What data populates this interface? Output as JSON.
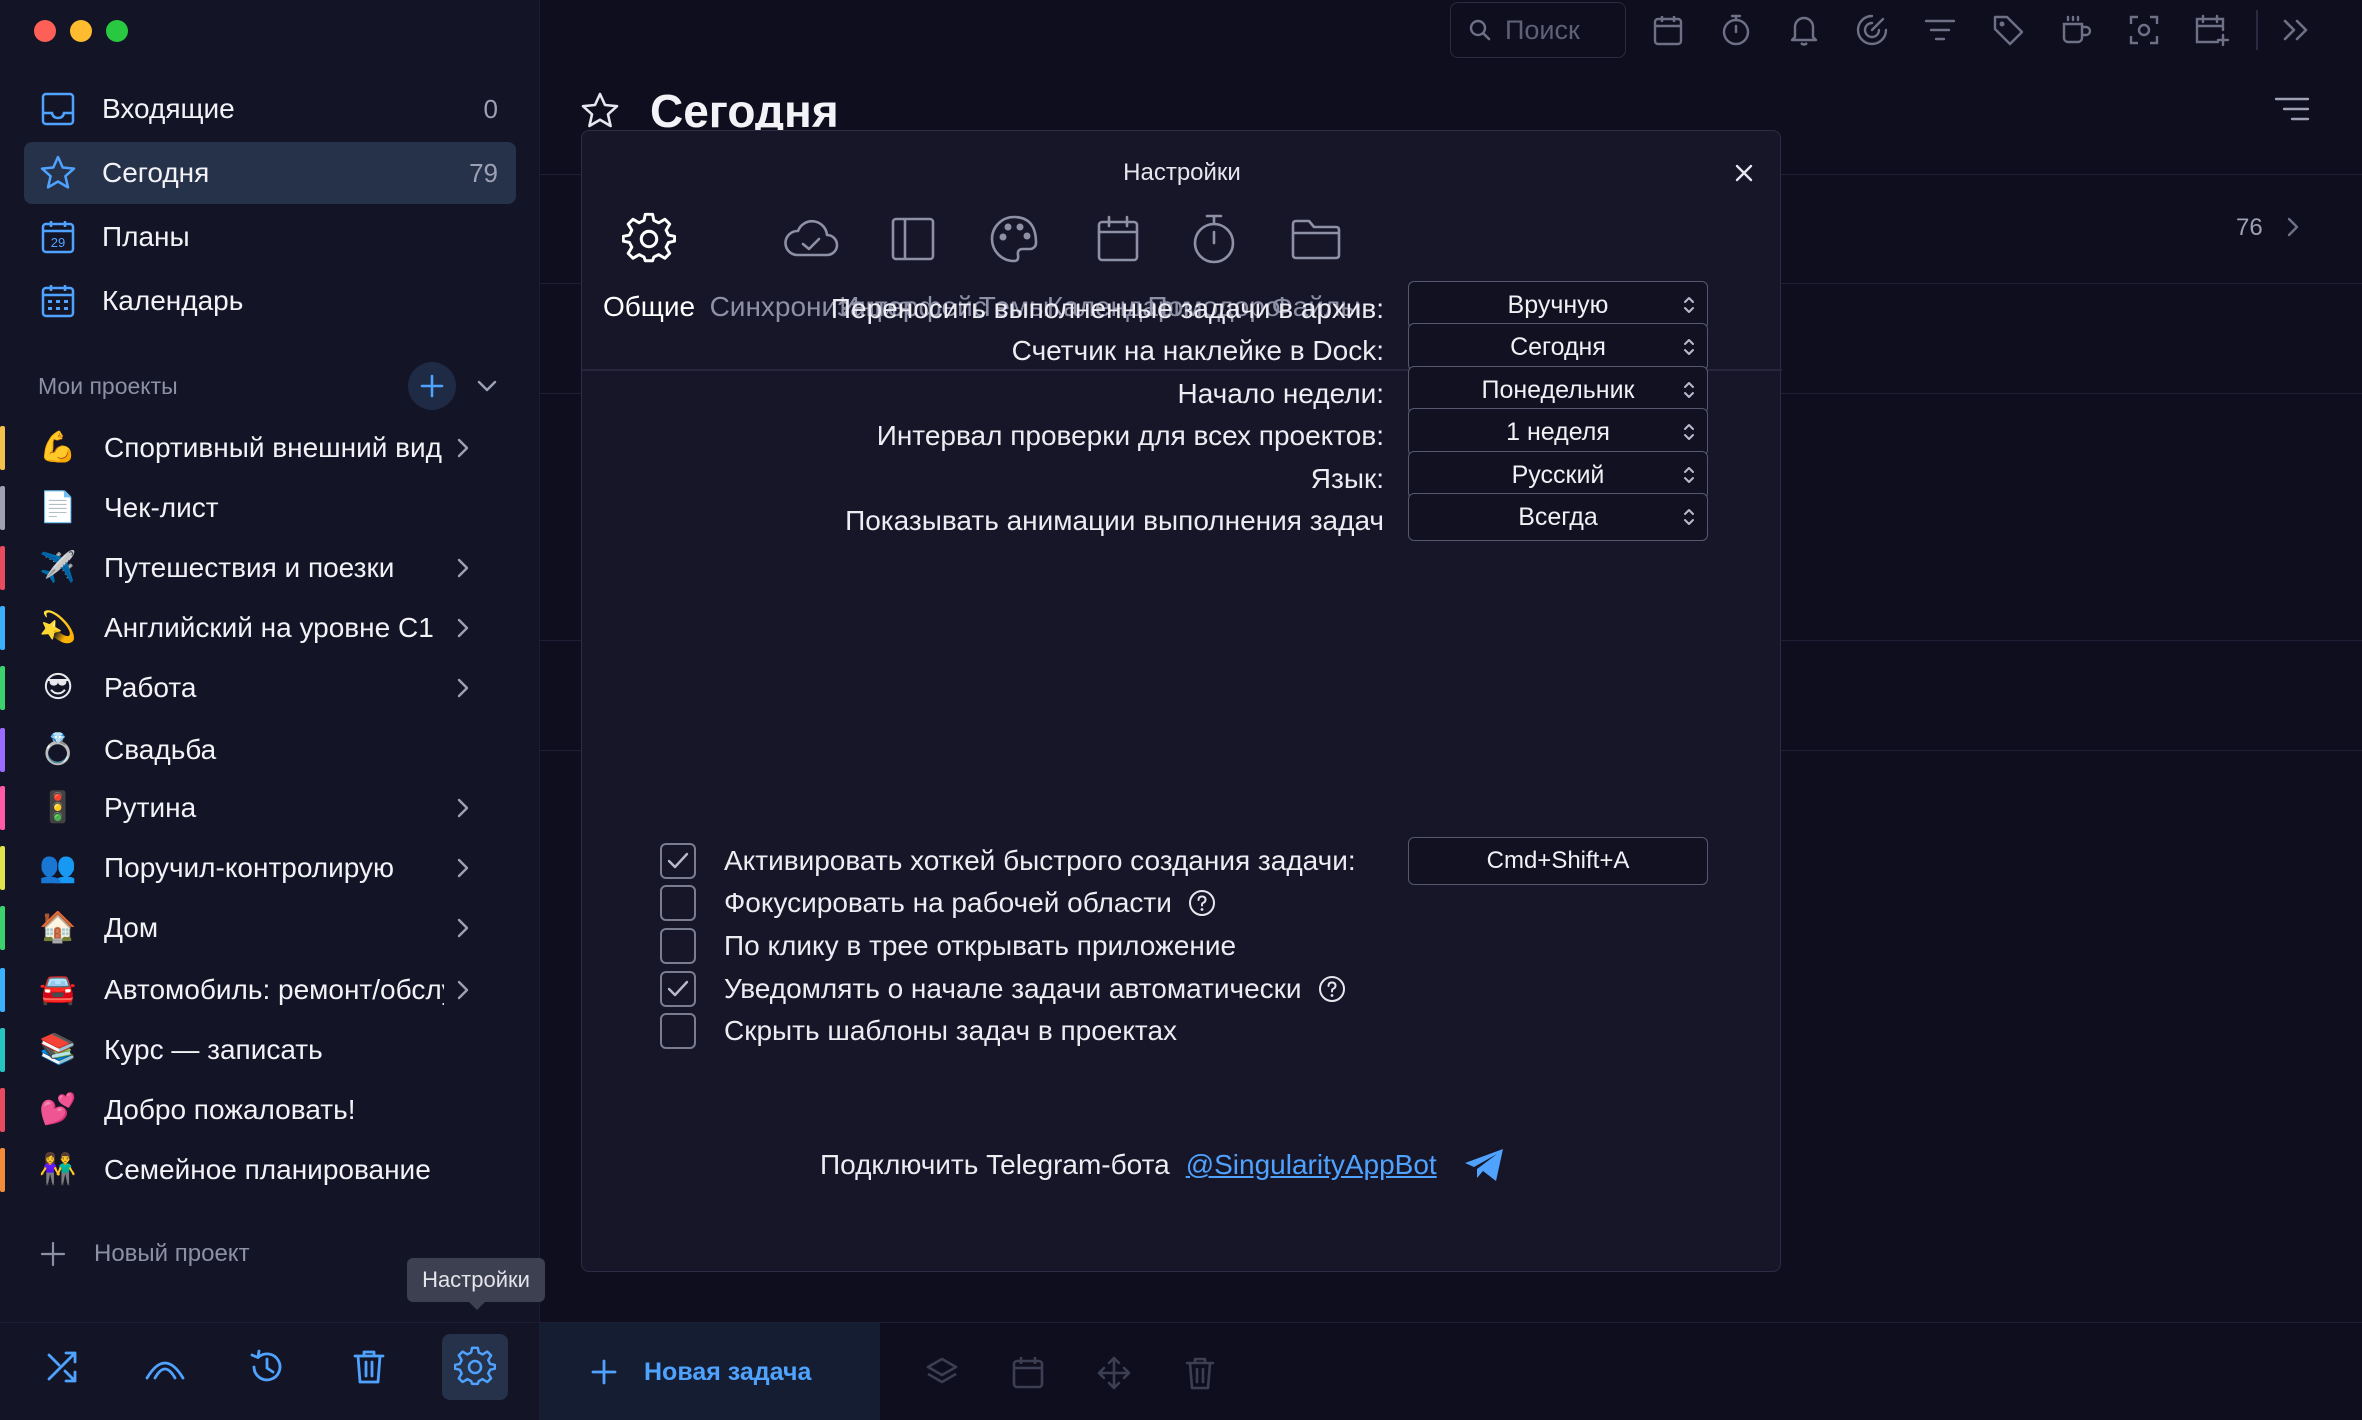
{
  "sidebar": {
    "nav": [
      {
        "label": "Входящие",
        "count": "0"
      },
      {
        "label": "Сегодня",
        "count": "79"
      },
      {
        "label": "Планы",
        "count": ""
      },
      {
        "label": "Календарь",
        "count": ""
      }
    ],
    "plans_icon_day": "29",
    "projects_header": "Мои проекты",
    "projects": [
      {
        "emoji": "💪",
        "label": "Спортивный внешний вид",
        "color": "#f2c14e"
      },
      {
        "emoji": "📄",
        "label": "Чек-лист",
        "color": "#a0a0b0"
      },
      {
        "emoji": "✈️",
        "label": "Путешествия и поезки",
        "color": "#e84a5f"
      },
      {
        "emoji": "💫",
        "label": "Английский на уровне C1",
        "color": "#3ab0ff"
      },
      {
        "emoji": "😎",
        "label": "Работа",
        "color": "#3bd16f"
      },
      {
        "emoji": "💍",
        "label": "Свадьба",
        "color": "#9b6bff"
      },
      {
        "emoji": "🚦",
        "label": "Рутина",
        "color": "#ff5aa5"
      },
      {
        "emoji": "👥",
        "label": "Поручил-контролирую",
        "color": "#e2e24a"
      },
      {
        "emoji": "🏠",
        "label": "Дом",
        "color": "#3bd16f"
      },
      {
        "emoji": "🚘",
        "label": "Автомобиль: ремонт/обслуживание",
        "color": "#3ab0ff"
      },
      {
        "emoji": "📚",
        "label": "Курс — записать",
        "color": "#27c4c4"
      },
      {
        "emoji": "💕",
        "label": "Добро пожаловать!",
        "color": "#e84a5f"
      },
      {
        "emoji": "👫",
        "label": "Семейное планирование",
        "color": "#f28c3a"
      }
    ],
    "new_project": "Новый проект",
    "tooltip": "Настройки"
  },
  "toolbar": {
    "search_placeholder": "Поиск"
  },
  "main": {
    "title": "Сегодня",
    "background_count": "76",
    "new_task": "Новая задача"
  },
  "settings": {
    "title": "Настройки",
    "tabs": [
      {
        "label": "Общие",
        "icon": "gear-icon",
        "active": true
      },
      {
        "label": "Синхронизация",
        "icon": "cloud-check-icon"
      },
      {
        "label": "Интерфейс",
        "icon": "layout-icon"
      },
      {
        "label": "Темы",
        "icon": "palette-icon"
      },
      {
        "label": "Календари",
        "icon": "calendar-icon"
      },
      {
        "label": "Помодоро",
        "icon": "stopwatch-icon"
      },
      {
        "label": "Файлы",
        "icon": "folder-icon"
      }
    ],
    "rows": [
      {
        "label": "Переносить выполненные задачи в архив:",
        "value": "Вручную"
      },
      {
        "label": "Счетчик на наклейке в Dock:",
        "value": "Сегодня"
      },
      {
        "label": "Начало недели:",
        "value": "Понедельник"
      },
      {
        "label": "Интервал проверки для всех проектов:",
        "value": "1 неделя"
      },
      {
        "label": "Язык:",
        "value": "Русский"
      },
      {
        "label": "Показывать анимации выполнения задач",
        "value": "Всегда"
      }
    ],
    "checks": [
      {
        "label": "Активировать хоткей быстрого создания задачи:",
        "checked": true,
        "hotkey": "Cmd+Shift+A"
      },
      {
        "label": "Фокусировать на рабочей области",
        "checked": false,
        "help": true
      },
      {
        "label": "По клику в трее открывать приложение",
        "checked": false
      },
      {
        "label": "Уведомлять о начале задачи автоматически",
        "checked": true,
        "help": true
      },
      {
        "label": "Скрыть шаблоны задач в проектах",
        "checked": false
      }
    ],
    "telegram_label": "Подключить Telegram-бота",
    "telegram_link": "@SingularityAppBot"
  },
  "colors": {
    "accent": "#4fa3ff",
    "background": "#0f0e1f",
    "sidebar": "#141427",
    "active_item": "#26314a"
  }
}
